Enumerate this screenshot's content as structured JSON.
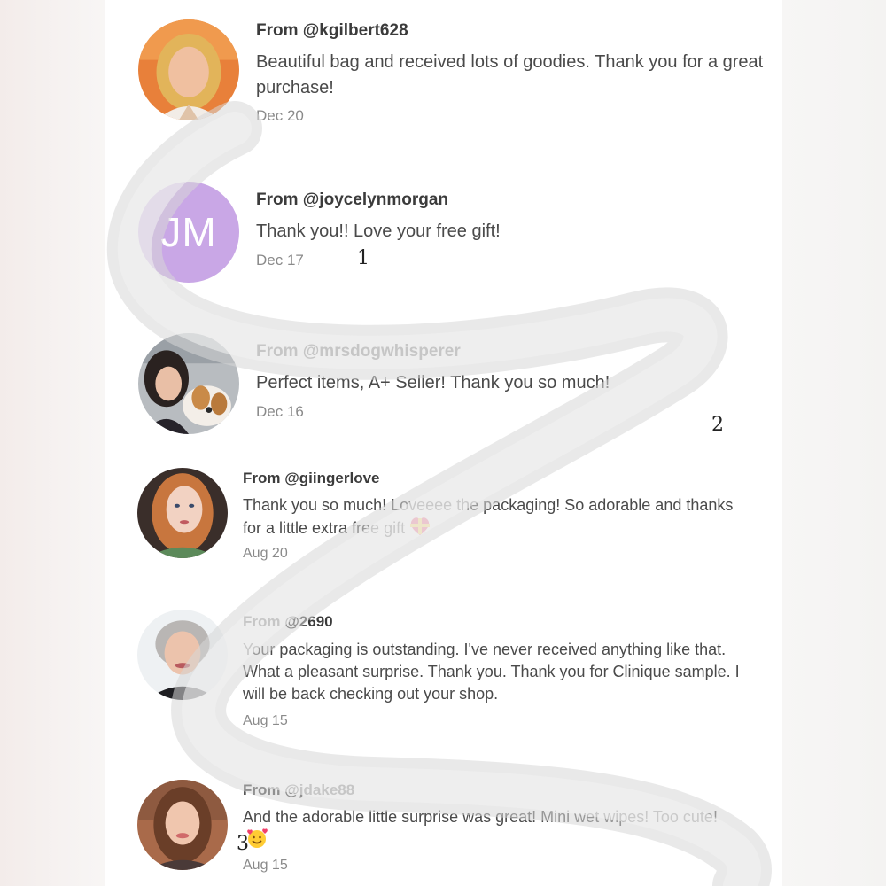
{
  "reviews": [
    {
      "username": "From @kgilbert628",
      "message": "Beautiful bag and received lots of goodies. Thank you for a great purchase!",
      "date": "Dec 20",
      "avatar": "photo-woman-blonde-orange"
    },
    {
      "username": "From @joycelynmorgan",
      "message": "Thank you!! Love your free gift!",
      "date": "Dec 17",
      "avatar_initials": "JM",
      "avatar_color": "#c9a7e6"
    },
    {
      "username": "From @mrsdogwhisperer",
      "message": "Perfect items, A+ Seller! Thank you so much!",
      "date": "Dec 16",
      "avatar": "photo-woman-with-dog"
    },
    {
      "username": "From @giingerlove",
      "message": "Thank you so much! Loveeee the packaging! So adorable and thanks for a little extra free gift",
      "date": "Aug 20",
      "avatar": "photo-woman-red-hair",
      "emoji": "heart-ribbon-emoji"
    },
    {
      "username": "From @2690",
      "message": "Your packaging is outstanding. I've never received anything like that. What a pleasant surprise. Thank you. Thank you for Clinique sample. I will be back checking out your shop.",
      "date": "Aug 15",
      "avatar": "photo-woman-short-gray-hair"
    },
    {
      "username": "From @jdake88",
      "message": "And the adorable little surprise was great! Mini wet wipes! Too cute!",
      "date": "Aug 15",
      "avatar": "photo-woman-brown-hair",
      "emoji": "smiling-face-with-hearts-emoji"
    }
  ],
  "markers": [
    "1",
    "2",
    "3"
  ]
}
